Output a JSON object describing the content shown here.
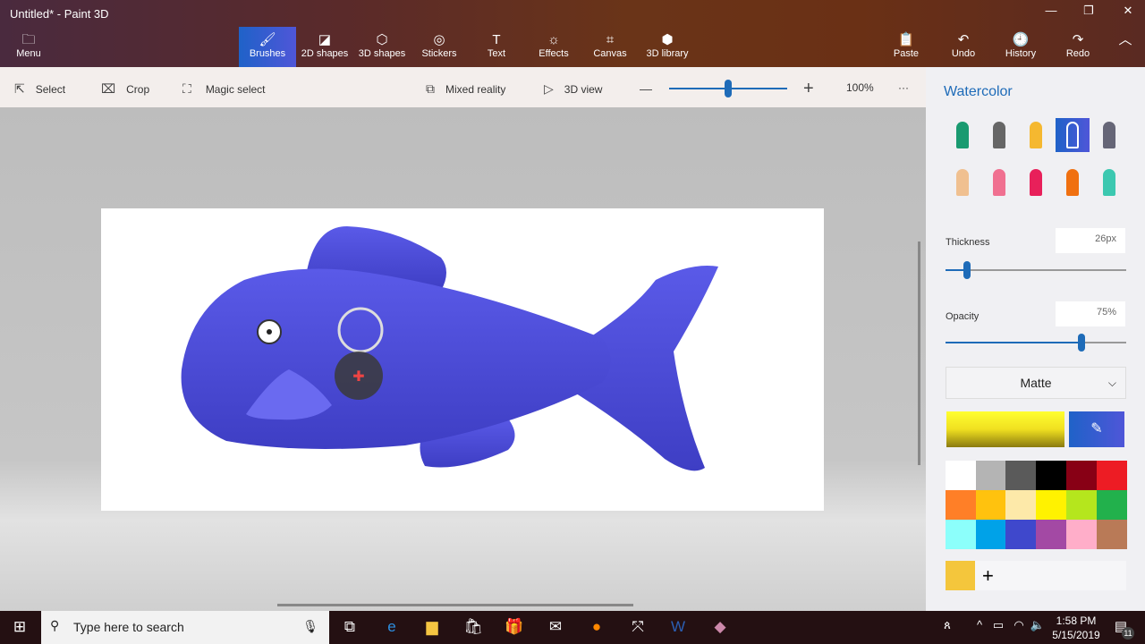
{
  "window": {
    "title": "Untitled* - Paint 3D",
    "minimize": "—",
    "maximize": "❐",
    "close": "✕"
  },
  "ribbon": {
    "menu": {
      "label": "Menu",
      "icon": "folder-icon"
    },
    "tabs": [
      {
        "label": "Brushes",
        "icon": "brush-icon",
        "active": true
      },
      {
        "label": "2D shapes",
        "icon": "2d-shapes-icon"
      },
      {
        "label": "3D shapes",
        "icon": "cube-icon"
      },
      {
        "label": "Stickers",
        "icon": "sticker-icon"
      },
      {
        "label": "Text",
        "icon": "text-icon"
      },
      {
        "label": "Effects",
        "icon": "sun-icon"
      },
      {
        "label": "Canvas",
        "icon": "canvas-icon"
      },
      {
        "label": "3D library",
        "icon": "3d-library-icon"
      }
    ],
    "right": [
      {
        "label": "Paste",
        "icon": "paste-icon"
      },
      {
        "label": "Undo",
        "icon": "undo-icon"
      },
      {
        "label": "History",
        "icon": "history-icon"
      },
      {
        "label": "Redo",
        "icon": "redo-icon"
      }
    ]
  },
  "toolbar": {
    "select": "Select",
    "crop": "Crop",
    "magic_select": "Magic select",
    "mixed_reality": "Mixed reality",
    "view3d": "3D view",
    "zoom": "100%",
    "zoom_fraction": 0.5,
    "more": "···"
  },
  "panel": {
    "title": "Watercolor",
    "brushes": [
      "marker",
      "calligraphy-pen",
      "oil-brush",
      "watercolor",
      "pixel-pen",
      "pencil",
      "eraser",
      "crayon",
      "spray-can",
      "fill"
    ],
    "selected_brush": "watercolor",
    "thickness_label": "Thickness",
    "thickness": "26px",
    "thickness_fraction": 0.12,
    "opacity_label": "Opacity",
    "opacity": "75%",
    "opacity_fraction": 0.75,
    "finish": "Matte",
    "current_color": "#f5e800",
    "palette": [
      "#ffffff",
      "#b4b4b4",
      "#5a5a5a",
      "#000000",
      "#880015",
      "#ed1c24",
      "#ff7f27",
      "#ffc20e",
      "#fde9a9",
      "#fff200",
      "#b5e61d",
      "#22b14c",
      "#8cfffb",
      "#00a2e8",
      "#3f48cc",
      "#a349a4",
      "#ffaec9",
      "#b97a57"
    ],
    "custom_color": "#f4c63c",
    "add": "+"
  },
  "canvas": {
    "fish_color": "#4f4fd8"
  },
  "taskbar": {
    "search_placeholder": "Type here to search",
    "time": "1:58 PM",
    "date": "5/15/2019",
    "notifications": "11"
  }
}
